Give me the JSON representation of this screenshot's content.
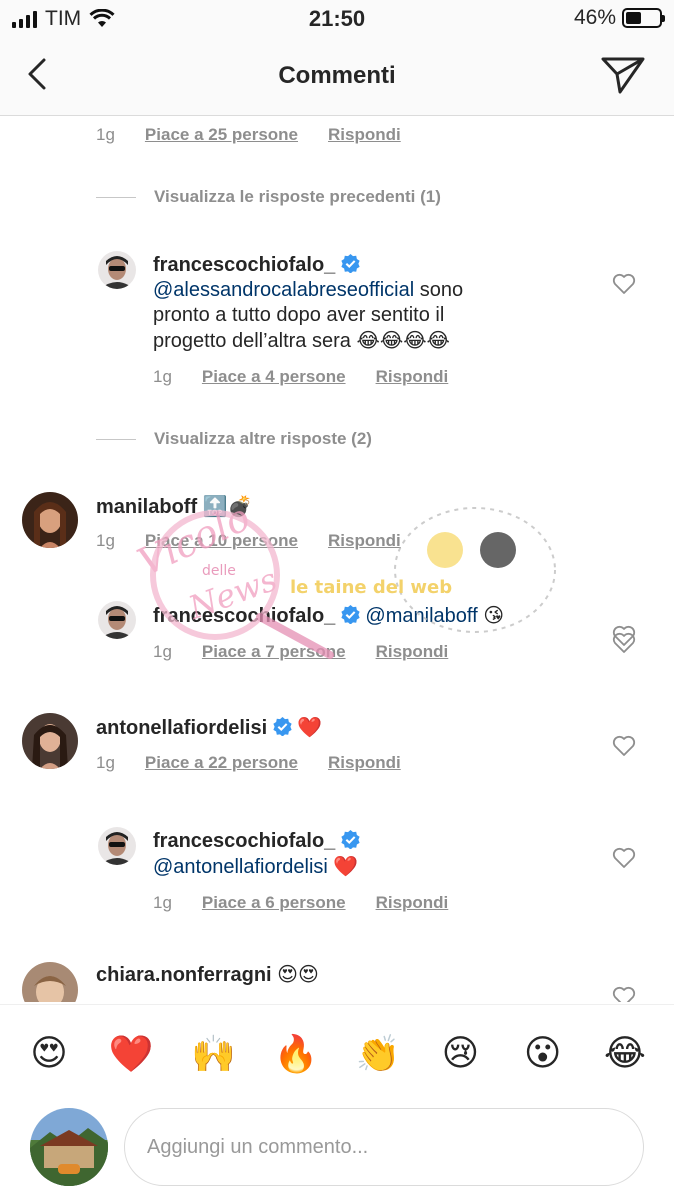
{
  "status_bar": {
    "carrier": "TIM",
    "time": "21:50",
    "battery": "46%",
    "battery_level": 0.46
  },
  "header": {
    "title": "Commenti"
  },
  "top_meta": {
    "time": "1g",
    "likes": "Piace a 25 persone",
    "reply": "Rispondi"
  },
  "toggles": {
    "previous_replies": "Visualizza le risposte precedenti (1)",
    "more_replies": "Visualizza altre risposte (2)"
  },
  "comments": [
    {
      "username": "francescochiofalo_",
      "mention": "@alessandrocalabreseofficial",
      "text_line1": " sono",
      "text_line2": "pronto a tutto dopo aver sentito il",
      "text_line3": "progetto dell’altra sera",
      "emoji": "😂😂😂😂",
      "time": "1g",
      "likes": "Piace a 4 persone",
      "reply": "Rispondi"
    },
    {
      "username": "manilaboff",
      "emoji": "🔝💣",
      "time": "1g",
      "likes": "Piace a 10 persone",
      "reply": "Rispondi"
    },
    {
      "username": "francescochiofalo_",
      "mention": "@manilaboff",
      "emoji": "😘",
      "time": "1g",
      "likes": "Piace a 7 persone",
      "reply": "Rispondi"
    },
    {
      "username": "antonellafiordelisi",
      "emoji": "❤️",
      "time": "1g",
      "likes": "Piace a 22 persone",
      "reply": "Rispondi"
    },
    {
      "username": "francescochiofalo_",
      "mention": "@antonellafiordelisi",
      "emoji": "❤️",
      "time": "1g",
      "likes": "Piace a 6 persone",
      "reply": "Rispondi"
    },
    {
      "username": "chiara.nonferragni",
      "emoji": "😍😍"
    }
  ],
  "reactions": [
    "😍",
    "❤️",
    "🙌",
    "🔥",
    "👏",
    "😢",
    "😮",
    "😂"
  ],
  "composer": {
    "placeholder": "Aggiungi un commento..."
  },
  "watermark": {
    "text1": "Vicolo",
    "text2": "delle",
    "text3": "News",
    "text4": "le taine del web"
  }
}
